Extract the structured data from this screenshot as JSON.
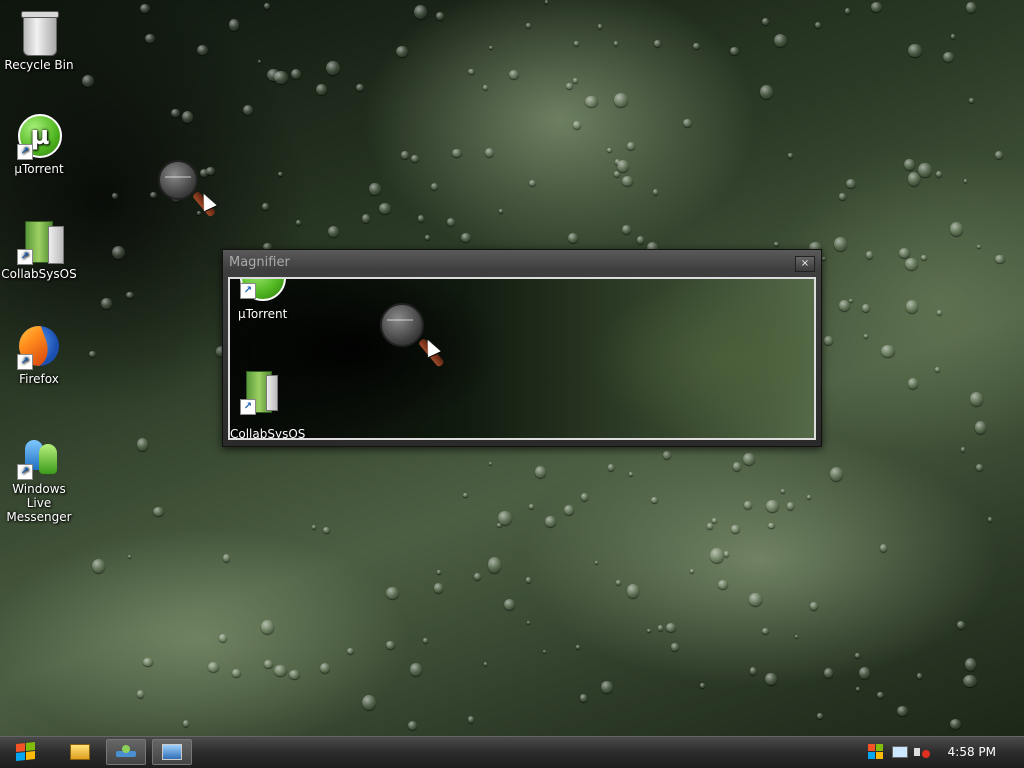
{
  "desktop": {
    "icons": [
      {
        "label": "Recycle Bin"
      },
      {
        "label": "µTorrent"
      },
      {
        "label": "CollabSysOS"
      },
      {
        "label": "Firefox"
      },
      {
        "label": "Windows Live Messenger"
      }
    ]
  },
  "magnifier": {
    "title": "Magnifier",
    "close_label": "×",
    "magnified_labels": [
      "µTorrent",
      "CollabSysOS"
    ]
  },
  "taskbar": {
    "clock": "4:58 PM"
  }
}
